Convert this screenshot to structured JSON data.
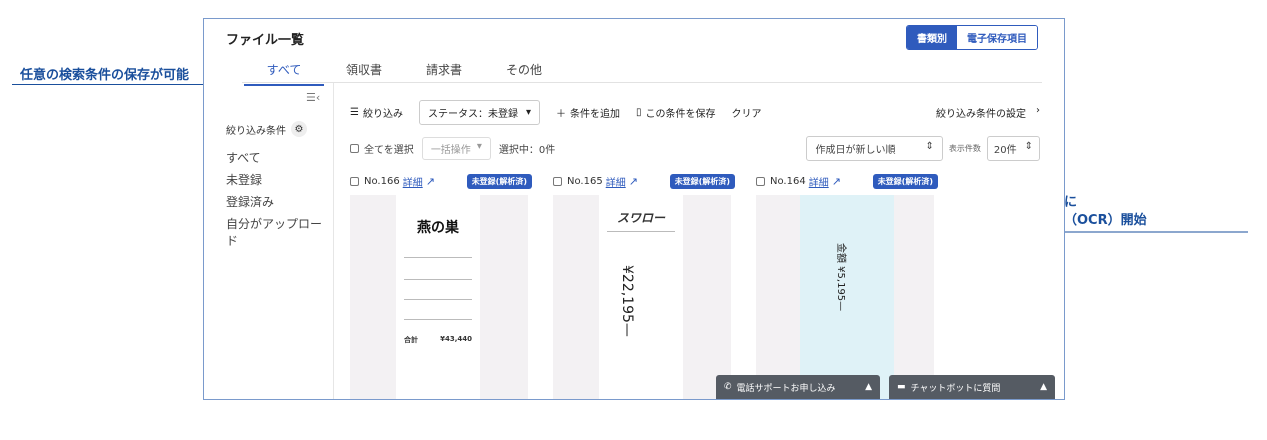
{
  "callouts": {
    "left": "任意の検索条件の保存が可能",
    "right_line1": "アップロード後に",
    "right_line2": "自動で数値解析（OCR）開始"
  },
  "header": {
    "title": "ファイル一覧",
    "view_by_type": "書類別",
    "view_by_field": "電子保存項目"
  },
  "tabs": [
    "すべて",
    "領収書",
    "請求書",
    "その他"
  ],
  "sidebar": {
    "filter_label": "絞り込み条件",
    "items": [
      "すべて",
      "未登録",
      "登録済み",
      "自分がアップロード"
    ]
  },
  "toolbar": {
    "filter": "絞り込み",
    "status": "ステータス：未登録",
    "add_condition": "条件を追加",
    "save_condition": "この条件を保存",
    "clear": "クリア",
    "filter_settings": "絞り込み条件の設定"
  },
  "list_controls": {
    "select_all": "全てを選択",
    "bulk_action": "一括操作",
    "selected_count": "選択中：0件",
    "sort": "作成日が新しい順",
    "per_page_label": "表示件数",
    "per_page": "20件"
  },
  "cards": [
    {
      "number": "No.166",
      "detail": "詳細",
      "badge": "未登録(解析済)",
      "shop": "燕の巣",
      "total_label": "合計",
      "total": "¥43,440"
    },
    {
      "number": "No.165",
      "detail": "詳細",
      "badge": "未登録(解析済)",
      "shop": "スワロー",
      "amount": "¥22,195—"
    },
    {
      "number": "No.164",
      "detail": "詳細",
      "badge": "未登録(解析済)",
      "amount": "金額 ¥5,195—"
    }
  ],
  "support": {
    "phone": "電話サポートお申し込み",
    "chat": "チャットボットに質問"
  }
}
